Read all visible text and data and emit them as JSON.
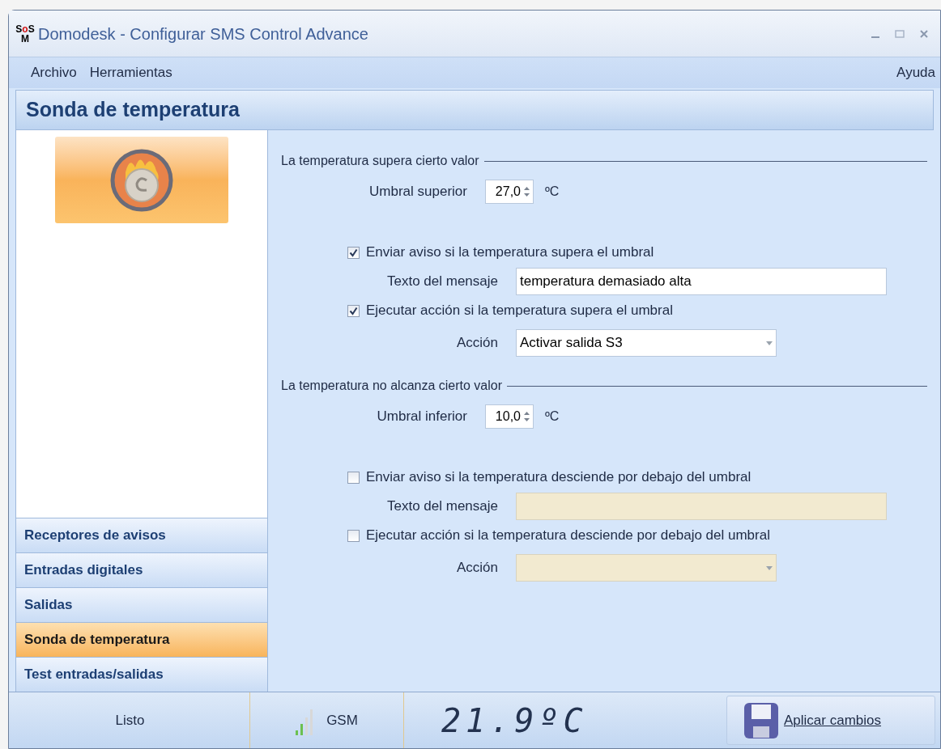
{
  "window": {
    "logo_top": "SoS",
    "logo_bottom": "M",
    "title": "Domodesk - Configurar SMS Control Advance"
  },
  "menu": {
    "left": [
      "Archivo",
      "Herramientas"
    ],
    "right": "Ayuda"
  },
  "header": "Sonda de temperatura",
  "sidebar": {
    "items": [
      {
        "label": "Receptores de avisos",
        "selected": false
      },
      {
        "label": "Entradas digitales",
        "selected": false
      },
      {
        "label": "Salidas",
        "selected": false
      },
      {
        "label": "Sonda de temperatura",
        "selected": true
      },
      {
        "label": "Test entradas/salidas",
        "selected": false
      }
    ]
  },
  "sections": [
    {
      "title": "La temperatura supera cierto valor",
      "threshold_label": "Umbral superior",
      "threshold_value": "27,0",
      "unit": "ºC",
      "rows": [
        {
          "kind": "check",
          "label": "Enviar aviso si la temperatura supera el umbral",
          "checked": true
        },
        {
          "kind": "text",
          "label": "Texto del mensaje",
          "value": "temperatura demasiado alta",
          "disabled": false
        },
        {
          "kind": "check",
          "label": "Ejecutar acción si la temperatura supera el umbral",
          "checked": true
        },
        {
          "kind": "select",
          "label": "Acción",
          "value": "Activar salida S3",
          "disabled": false
        }
      ]
    },
    {
      "title": "La temperatura no alcanza cierto valor",
      "threshold_label": "Umbral inferior",
      "threshold_value": "10,0",
      "unit": "ºC",
      "rows": [
        {
          "kind": "check",
          "label": "Enviar aviso si la temperatura desciende por debajo del umbral",
          "checked": false
        },
        {
          "kind": "text",
          "label": "Texto del mensaje",
          "disabled": true
        },
        {
          "kind": "check",
          "label": "Ejecutar acción si la temperatura desciende por debajo del umbral",
          "checked": false
        },
        {
          "kind": "select",
          "label": "Acción",
          "disabled": true
        }
      ]
    }
  ],
  "status_bar": {
    "status": "Listo",
    "network": "GSM",
    "temperature": "21.9ºC",
    "apply_button": "Aplicar cambios"
  }
}
